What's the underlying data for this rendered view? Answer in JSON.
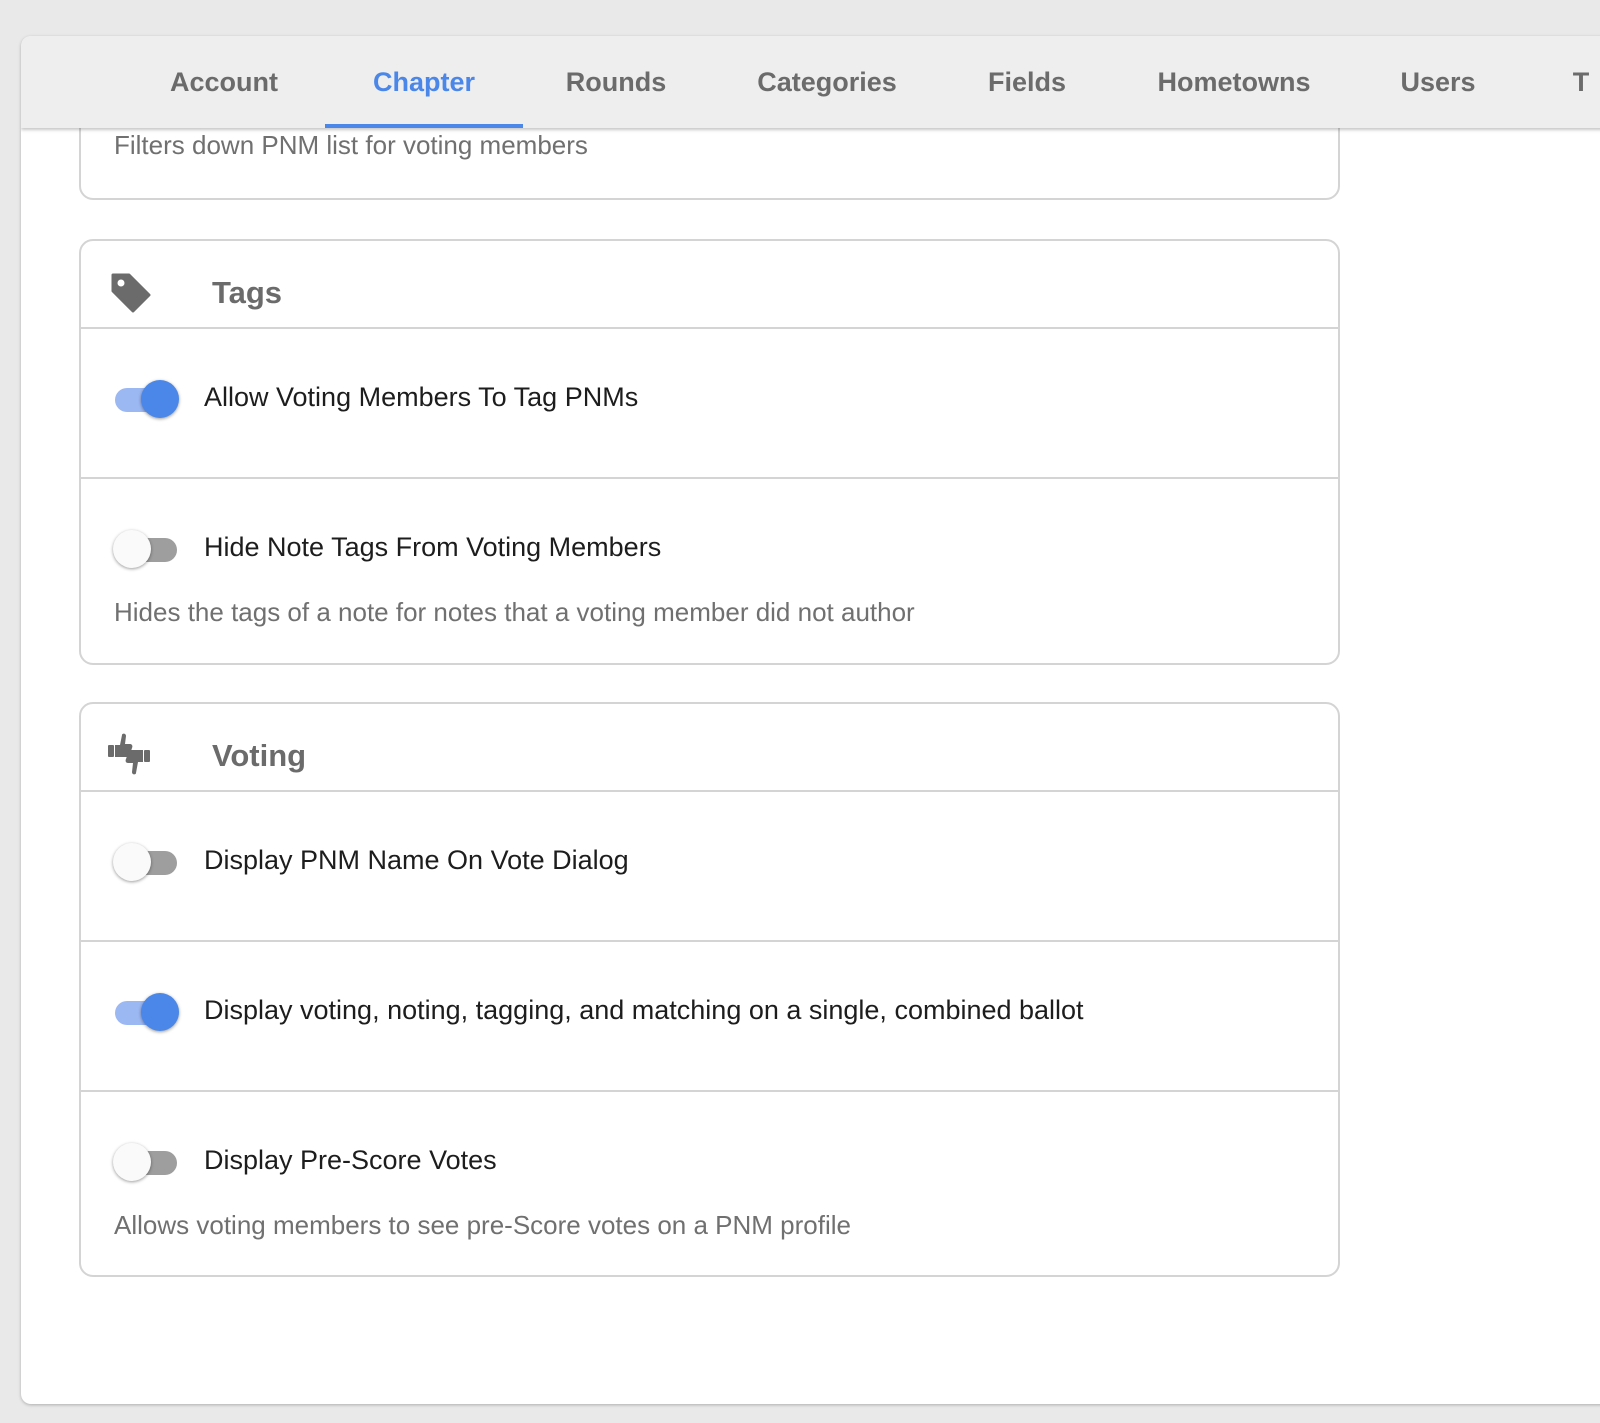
{
  "tabs": [
    {
      "label": "Account",
      "active": false
    },
    {
      "label": "Chapter",
      "active": true
    },
    {
      "label": "Rounds",
      "active": false
    },
    {
      "label": "Categories",
      "active": false
    },
    {
      "label": "Fields",
      "active": false
    },
    {
      "label": "Hometowns",
      "active": false
    },
    {
      "label": "Users",
      "active": false
    },
    {
      "label": "T",
      "active": false
    }
  ],
  "top_card": {
    "description": "Filters down PNM list for voting members"
  },
  "tags_card": {
    "title": "Tags",
    "icon": "tag-icon",
    "settings": [
      {
        "label": "Allow Voting Members To Tag PNMs",
        "enabled": true,
        "description": ""
      },
      {
        "label": "Hide Note Tags From Voting Members",
        "enabled": false,
        "description": "Hides the tags of a note for notes that a voting member did not author"
      }
    ]
  },
  "voting_card": {
    "title": "Voting",
    "icon": "thumbs-up-down-icon",
    "settings": [
      {
        "label": "Display PNM Name On Vote Dialog",
        "enabled": false,
        "description": ""
      },
      {
        "label": "Display voting, noting, tagging, and matching on a single, combined ballot",
        "enabled": true,
        "description": ""
      },
      {
        "label": "Display Pre-Score Votes",
        "enabled": false,
        "description": "Allows voting members to see pre-Score votes on a PNM profile"
      }
    ]
  },
  "colors": {
    "accent": "#4a87e8",
    "accent_track": "#9cb8f3",
    "tab_text": "#6b6b6b",
    "background": "#e9e9e9"
  }
}
